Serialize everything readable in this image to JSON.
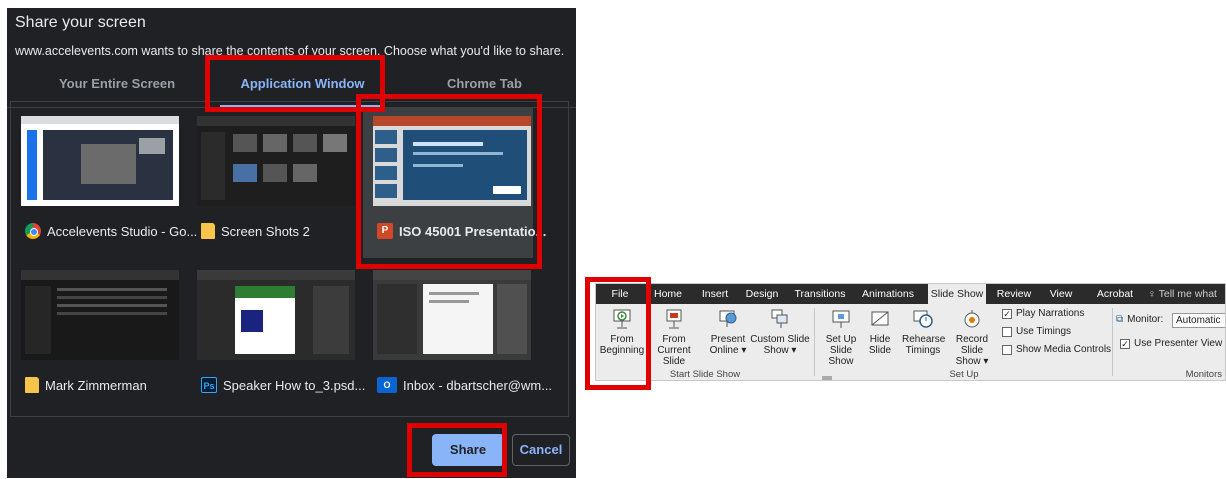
{
  "dialog": {
    "title": "Share your screen",
    "subtitle": "www.accelevents.com wants to share the contents of your screen. Choose what you'd like to share.",
    "tabs": [
      {
        "label": "Your Entire Screen"
      },
      {
        "label": "Application Window"
      },
      {
        "label": "Chrome Tab"
      }
    ],
    "windows": [
      {
        "label": "Accelevents Studio - Go...",
        "icon": "chrome-icon"
      },
      {
        "label": "Screen Shots 2",
        "icon": "folder-icon"
      },
      {
        "label": "ISO 45001 Presentatio...",
        "icon": "powerpoint-icon",
        "selected": true
      },
      {
        "label": "Mark Zimmerman",
        "icon": "folder-icon"
      },
      {
        "label": "Speaker How to_3.psd...",
        "icon": "photoshop-icon",
        "icon_text": "Ps"
      },
      {
        "label": "Inbox - dbartscher@wm...",
        "icon": "outlook-icon",
        "icon_text": "O"
      }
    ],
    "share_label": "Share",
    "cancel_label": "Cancel",
    "ppt_icon_text": "P"
  },
  "ribbon": {
    "tabs": [
      "File",
      "Home",
      "Insert",
      "Design",
      "Transitions",
      "Animations",
      "Slide Show",
      "Review",
      "View",
      "Acrobat",
      "Tell me what"
    ],
    "active_tab": "Slide Show",
    "buttons": {
      "from_beginning": [
        "From",
        "Beginning"
      ],
      "from_current": [
        "From",
        "Current Slide"
      ],
      "present_online": [
        "Present",
        "Online ▾"
      ],
      "custom_show": [
        "Custom Slide",
        "Show ▾"
      ],
      "set_up": [
        "Set Up",
        "Slide Show"
      ],
      "hide_slide": [
        "Hide",
        "Slide"
      ],
      "rehearse": [
        "Rehearse",
        "Timings"
      ],
      "record": [
        "Record Slide",
        "Show ▾"
      ]
    },
    "checks": {
      "play_narrations": "Play Narrations",
      "use_timings": "Use Timings",
      "show_media": "Show Media Controls",
      "use_presenter": "Use Presenter View"
    },
    "monitor_label": "Monitor:",
    "monitor_value": "Automatic",
    "groups": {
      "start": "Start Slide Show",
      "setup": "Set Up",
      "monitors": "Monitors"
    }
  },
  "colors": {
    "dialog_bg": "#202124",
    "accent_blue": "#8ab4f8",
    "highlight_red": "#e00000"
  }
}
